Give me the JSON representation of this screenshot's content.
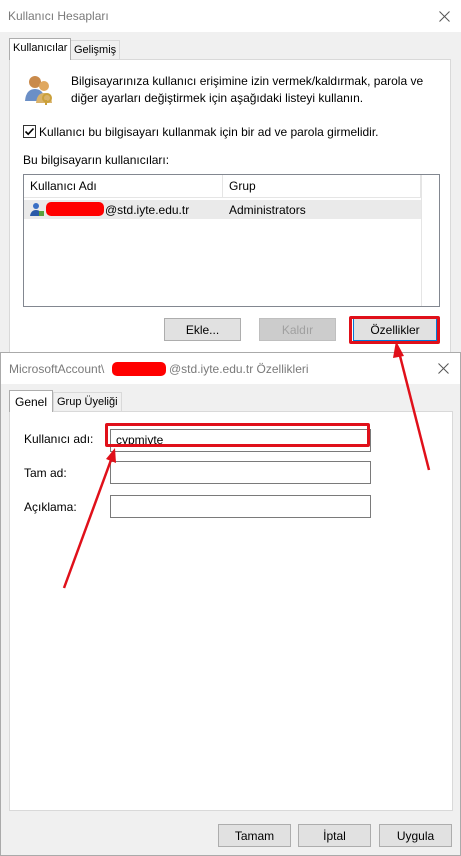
{
  "back_window": {
    "title": "Kullanıcı Hesapları",
    "tabs": [
      "Kullanıcılar",
      "Gelişmiş"
    ],
    "intro_text_line1": "Bilgisayarınıza kullanıcı erişimine izin vermek/kaldırmak, parola ve",
    "intro_text_line2": "diğer ayarları değiştirmek için aşağıdaki listeyi kullanın.",
    "checkbox_label": "Kullanıcı bu bilgisayarı kullanmak için bir ad ve parola girmelidir.",
    "checkbox_checked": true,
    "users_label": "Bu bilgisayarın kullanıcıları:",
    "columns": [
      "Kullanıcı Adı",
      "Grup"
    ],
    "rows": [
      {
        "user_suffix": "@std.iyte.edu.tr",
        "group": "Administrators"
      }
    ],
    "buttons": {
      "add": "Ekle...",
      "remove": "Kaldır",
      "properties": "Özellikler"
    }
  },
  "front_window": {
    "title_prefix": "MicrosoftAccount\\",
    "title_suffix": "@std.iyte.edu.tr Özellikleri",
    "tabs": [
      "Genel",
      "Grup Üyeliği"
    ],
    "fields": {
      "username_label": "Kullanıcı adı:",
      "username_value": "cypmiyte",
      "fullname_label": "Tam ad:",
      "fullname_value": "",
      "description_label": "Açıklama:",
      "description_value": ""
    },
    "buttons": {
      "ok": "Tamam",
      "cancel": "İptal",
      "apply": "Uygula"
    }
  },
  "annotation_color": "#e0101a",
  "redaction_color": "#ff0000"
}
